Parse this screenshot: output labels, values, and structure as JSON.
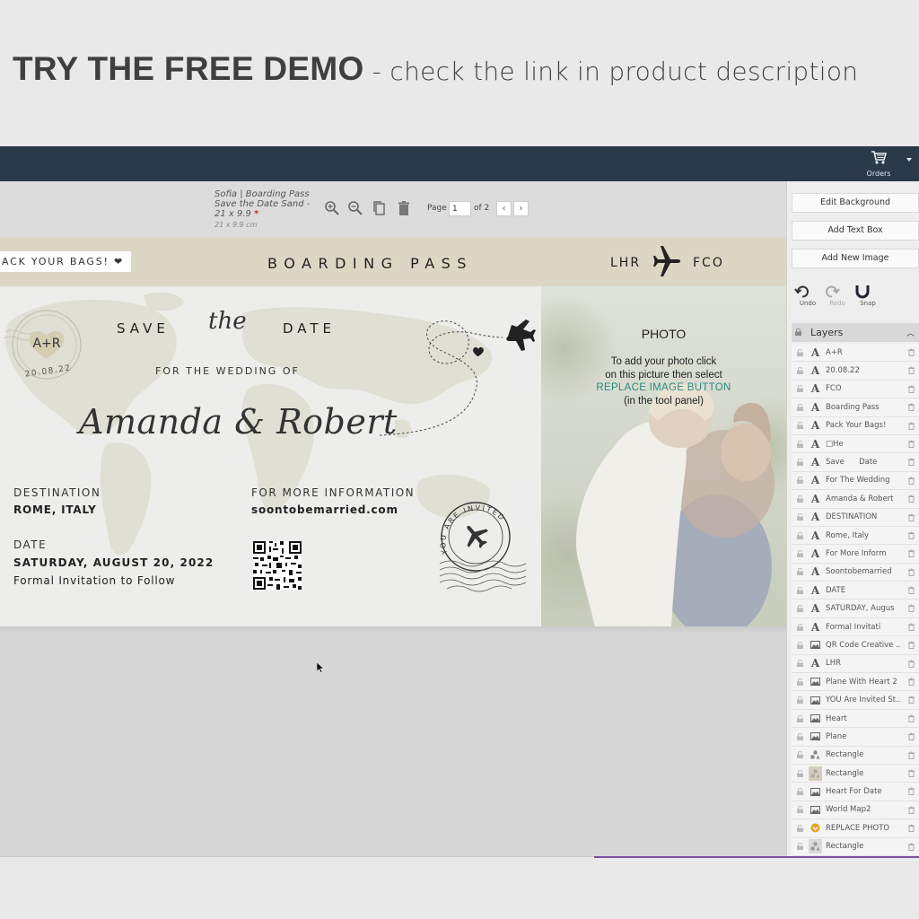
{
  "promo": {
    "strong": "TRY THE FREE DEMO",
    "separator": " - ",
    "light": "check the link in product description"
  },
  "topbar": {
    "orders_label": "Orders",
    "cart_icon": "cart-icon"
  },
  "toolbar": {
    "design_title": "Sofia | Boarding Pass Save the Date Sand - 21 x 9.9",
    "required_mark": "*",
    "design_size": "21 x 9.9 cm",
    "page_label": "Page",
    "page_value": "1",
    "page_of": "of 2",
    "prev": "‹",
    "next": "›"
  },
  "card": {
    "pack_badge": "ACK YOUR BAGS! ❤",
    "boarding_pass": "BOARDING PASS",
    "origin": "LHR",
    "destination_code": "FCO",
    "seal_initials": "A+R",
    "seal_date": "20.08.22",
    "save": "SAVE",
    "the": "the",
    "date_word": "DATE",
    "for_wedding": "FOR THE WEDDING OF",
    "names": "Amanda & Robert",
    "destination_label": "DESTINATION",
    "destination_value": "ROME, ITALY",
    "date_label": "DATE",
    "date_value": "SATURDAY, AUGUST 20, 2022",
    "formal": "Formal Invitation to Follow",
    "info_label": "FOR MORE INFORMATION",
    "info_value": "soontobemarried.com",
    "stamp_text": "YOU ARE INVITED"
  },
  "photo": {
    "heading": "PHOTO",
    "line1": "To add your photo click",
    "line2": "on this picture then select",
    "accent": "REPLACE IMAGE BUTTON",
    "line3": "(in the tool panel)"
  },
  "panel": {
    "edit_background": "Edit Background",
    "add_text_box": "Add Text Box",
    "add_new_image": "Add New Image",
    "undo": "Undo",
    "redo": "Redo",
    "snap": "Snap",
    "layers_title": "Layers",
    "layers": [
      {
        "type": "text",
        "name": "A+R"
      },
      {
        "type": "text",
        "name": "20.08.22"
      },
      {
        "type": "text",
        "name": "FCO"
      },
      {
        "type": "text",
        "name": "Boarding Pass"
      },
      {
        "type": "text",
        "name": "Pack Your Bags!"
      },
      {
        "type": "text",
        "name": "□He"
      },
      {
        "type": "text",
        "name": "Save      Date"
      },
      {
        "type": "text",
        "name": "For The Wedding"
      },
      {
        "type": "text",
        "name": "Amanda & Robert"
      },
      {
        "type": "text",
        "name": "DESTINATION"
      },
      {
        "type": "text",
        "name": "Rome, Italy"
      },
      {
        "type": "text",
        "name": "For More Inform"
      },
      {
        "type": "text",
        "name": "Soontobemarried"
      },
      {
        "type": "text",
        "name": "DATE"
      },
      {
        "type": "text",
        "name": "SATURDAY, Augus"
      },
      {
        "type": "text",
        "name": "Formal Invitati"
      },
      {
        "type": "image",
        "name": "QR Code Creative ..."
      },
      {
        "type": "text",
        "name": "LHR"
      },
      {
        "type": "image",
        "name": "Plane With Heart 2"
      },
      {
        "type": "image",
        "name": "YOU Are Invited St..."
      },
      {
        "type": "image",
        "name": "Heart"
      },
      {
        "type": "image",
        "name": "Plane"
      },
      {
        "type": "shape",
        "name": "Rectangle"
      },
      {
        "type": "swatch",
        "name": "Rectangle"
      },
      {
        "type": "image",
        "name": "Heart For Date"
      },
      {
        "type": "image",
        "name": "World Map2"
      },
      {
        "type": "replace",
        "name": "REPLACE PHOTO"
      },
      {
        "type": "swatch-grey",
        "name": "Rectangle"
      }
    ]
  }
}
